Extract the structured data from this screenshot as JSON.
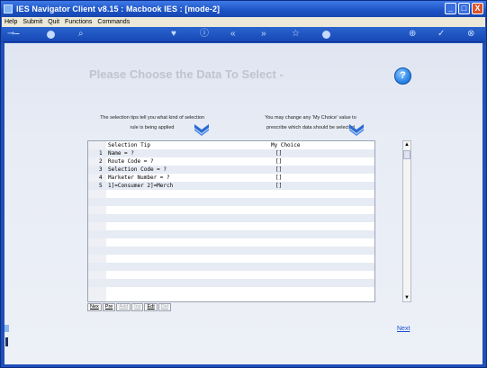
{
  "window": {
    "title": "IES Navigator Client v8.15 : Macbook IES :      [mode-2]",
    "buttons": [
      "_",
      "□",
      "X"
    ]
  },
  "menu": [
    "Help",
    "Submit",
    "Quit",
    "Functions",
    "Commands"
  ],
  "page": {
    "heading": "Please Choose the Data To Select -",
    "help_label": "?",
    "tip_left": "The selection tips tell you what kind of selection rule is being applied",
    "tip_right": "You may change any 'My Choice' value to prescribe which data should be selected"
  },
  "grid": {
    "col_tip": "Selection Tip",
    "col_choice": "My Choice",
    "rows": [
      {
        "num": "1",
        "tip": "Name = ?",
        "choice": "[]"
      },
      {
        "num": "2",
        "tip": "Route Code = ?",
        "choice": "[]"
      },
      {
        "num": "3",
        "tip": "Selection Code = ?",
        "choice": "[]"
      },
      {
        "num": "4",
        "tip": "Marketer Number = ?",
        "choice": "[]"
      },
      {
        "num": "5",
        "tip": "1]=Consumer 2]=Merch",
        "choice": "[]"
      }
    ]
  },
  "nav": {
    "nex": "Nex",
    "pre": "Pre",
    "add": "Add",
    "ins": "Ins",
    "edit": "Edt",
    "del": "Del"
  },
  "next_label": "Next",
  "colors": {
    "frame": "#1f4fb8",
    "content_bg": "#e8ecf5",
    "heading": "#bfc4cf",
    "link": "#1a4fd0"
  },
  "icons": [
    "key-icon",
    "help-icon",
    "search-icon",
    "heart-icon",
    "info-icon",
    "back-icon",
    "forward-icon",
    "star-icon",
    "home-icon",
    "add-icon",
    "check-icon",
    "close-icon"
  ]
}
